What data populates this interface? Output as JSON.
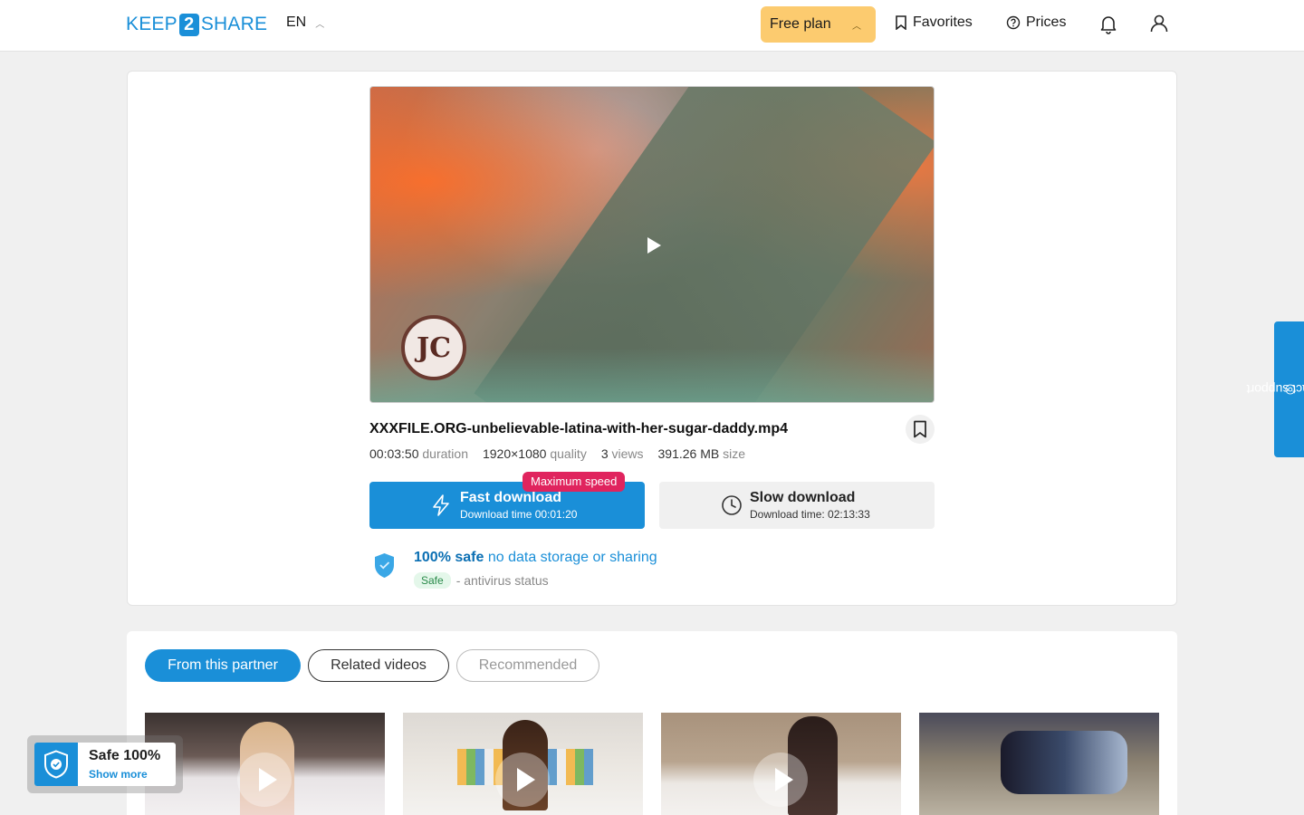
{
  "header": {
    "logo_left": "KEEP",
    "logo_mid": "2",
    "logo_right": "SHARE",
    "language": "EN",
    "plan_label": "Free plan",
    "favorites_label": "Favorites",
    "prices_label": "Prices"
  },
  "file": {
    "name": "XXXFILE.ORG-unbelievable-latina-with-her-sugar-daddy.mp4",
    "duration": "00:03:50",
    "duration_unit": "duration",
    "resolution": "1920×1080",
    "resolution_unit": "quality",
    "views": "3",
    "views_unit": "views",
    "size": "391.26 MB",
    "size_unit": "size"
  },
  "download": {
    "max_speed_badge": "Maximum speed",
    "fast_label": "Fast download",
    "fast_time": "Download time 00:01:20",
    "slow_label": "Slow download",
    "slow_time": "Download time: 02:13:33"
  },
  "safety": {
    "safe_bold": "100% safe",
    "safe_rest": "no data storage or sharing",
    "av_badge": "Safe",
    "av_text": "- antivirus status"
  },
  "related": {
    "tabs": [
      {
        "label": "From this partner",
        "state": "active"
      },
      {
        "label": "Related videos",
        "state": "outline"
      },
      {
        "label": "Recommended",
        "state": "disabled"
      }
    ]
  },
  "support": {
    "label": "contact support"
  },
  "safe_widget": {
    "title": "Safe 100%",
    "link": "Show more"
  },
  "colors": {
    "accent": "#1a8fd8",
    "plan": "#fccb6f",
    "badge": "#e0245e"
  }
}
